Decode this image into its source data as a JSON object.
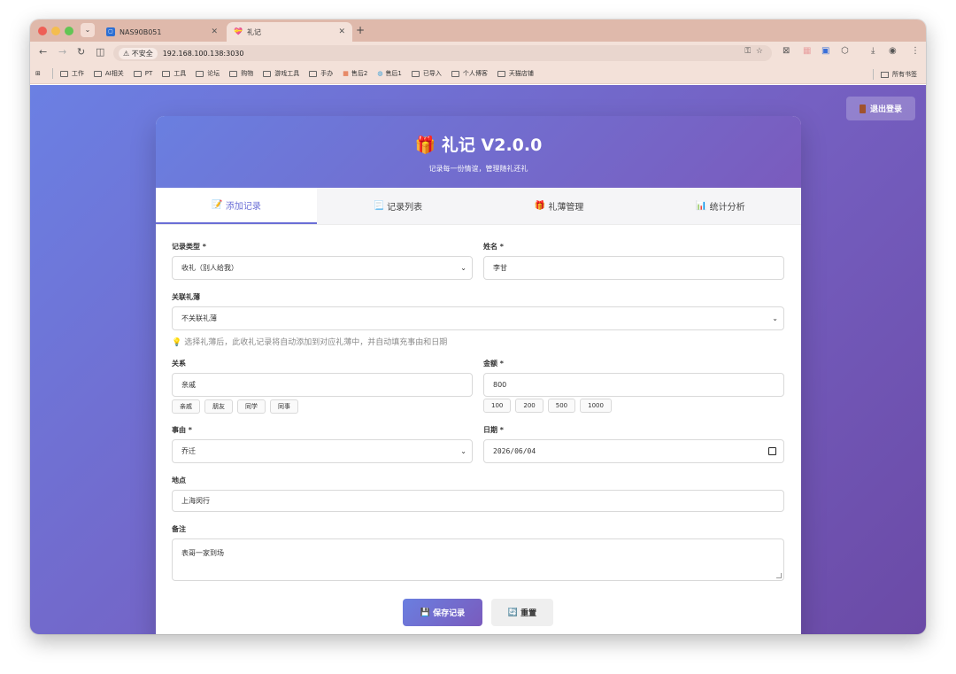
{
  "browser": {
    "tabs": [
      {
        "label": "NAS90B051",
        "active": false
      },
      {
        "label": "礼记",
        "active": true
      }
    ],
    "insecure_label": "不安全",
    "url": "192.168.100.138:3030",
    "bookmarks": [
      "工作",
      "AI相关",
      "PT",
      "工具",
      "论坛",
      "购物",
      "游戏工具",
      "手办",
      "售后2",
      "售后1",
      "已导入",
      "个人博客",
      "天猫店铺"
    ],
    "all_bookmarks": "所有书签"
  },
  "app": {
    "title": "🎁 礼记 V2.0.0",
    "subtitle": "记录每一份情谊，管理随礼还礼",
    "logout": "退出登录"
  },
  "tabs": [
    {
      "icon": "📝",
      "label": "添加记录",
      "active": true
    },
    {
      "icon": "📃",
      "label": "记录列表",
      "active": false
    },
    {
      "icon": "🎁",
      "label": "礼薄管理",
      "active": false
    },
    {
      "icon": "📊",
      "label": "统计分析",
      "active": false
    }
  ],
  "form": {
    "type_label": "记录类型 *",
    "type_value": "收礼（别人给我）",
    "name_label": "姓名 *",
    "name_value": "李甘",
    "book_label": "关联礼薄",
    "book_value": "不关联礼薄",
    "hint": "选择礼薄后，此收礼记录将自动添加到对应礼薄中，并自动填充事由和日期",
    "relation_label": "关系",
    "relation_value": "亲戚",
    "relation_chips": [
      "亲戚",
      "朋友",
      "同学",
      "同事"
    ],
    "amount_label": "金额 *",
    "amount_value": "800",
    "amount_chips": [
      "100",
      "200",
      "500",
      "1000"
    ],
    "reason_label": "事由 *",
    "reason_value": "乔迁",
    "date_label": "日期 *",
    "date_value": "2026/06/04",
    "location_label": "地点",
    "location_value": "上海闵行",
    "note_label": "备注",
    "note_value": "表哥一家到场",
    "save_label": "保存记录",
    "reset_label": "重置"
  }
}
